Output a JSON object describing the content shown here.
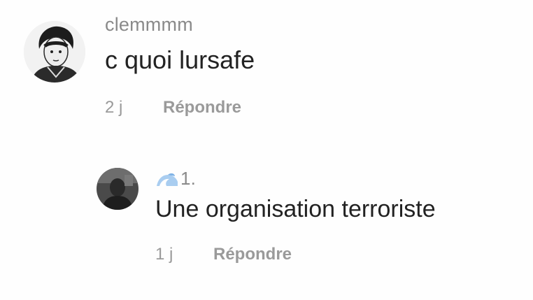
{
  "comment": {
    "username": "clemmmm",
    "text": "c quoi lursafe",
    "age": "2 j",
    "reply_label": "Répondre"
  },
  "reply": {
    "username": "1.",
    "username_emoji_icon": "wave-emoji-icon",
    "text": "Une organisation terroriste",
    "age": "1 j",
    "reply_label": "Répondre"
  },
  "colors": {
    "username": "#8a8a8a",
    "body_text": "#222222",
    "meta": "#9a9a9a",
    "emoji_blue": "#7fb2e6"
  }
}
